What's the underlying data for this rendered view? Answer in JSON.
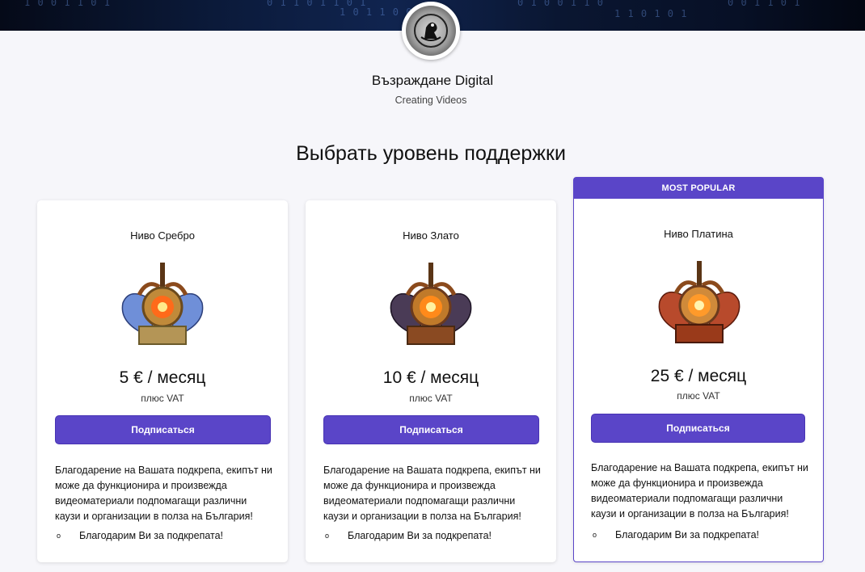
{
  "creator": {
    "name": "Възраждане Digital",
    "tagline": "Creating Videos"
  },
  "section_title": "Выбрать уровень поддержки",
  "tiers": [
    {
      "name": "Ниво Сребро",
      "price": "5 € / месяц",
      "vat": "плюс VAT",
      "button": "Подписаться",
      "description": "Благодарение на Вашата подкрепа, екипът ни може да функционира и произвежда видеоматериали подпомагащи различни каузи и организации в полза на България!",
      "bullet": "Благодарим Ви за подкрепата!",
      "wing_color": "#6f8fd8"
    },
    {
      "name": "Ниво Злато",
      "price": "10 € / месяц",
      "vat": "плюс VAT",
      "button": "Подписаться",
      "description": "Благодарение на Вашата подкрепа, екипът ни може да функционира и произвежда видеоматериали подпомагащи различни каузи и организации в полза на България!",
      "bullet": "Благодарим Ви за подкрепата!",
      "wing_color": "#4a3b56"
    },
    {
      "badge": "MOST POPULAR",
      "name": "Ниво Платина",
      "price": "25 € / месяц",
      "vat": "плюс VAT",
      "button": "Подписаться",
      "description": "Благодарение на Вашата подкрепа, екипът ни може да функционира и произвежда видеоматериали подпомагащи различни каузи и организации в полза на България!",
      "bullet": "Благодарим Ви за подкрепата!",
      "wing_color": "#b84a2c"
    }
  ],
  "colors": {
    "accent": "#5a45c8",
    "background": "#f6f6fa"
  }
}
